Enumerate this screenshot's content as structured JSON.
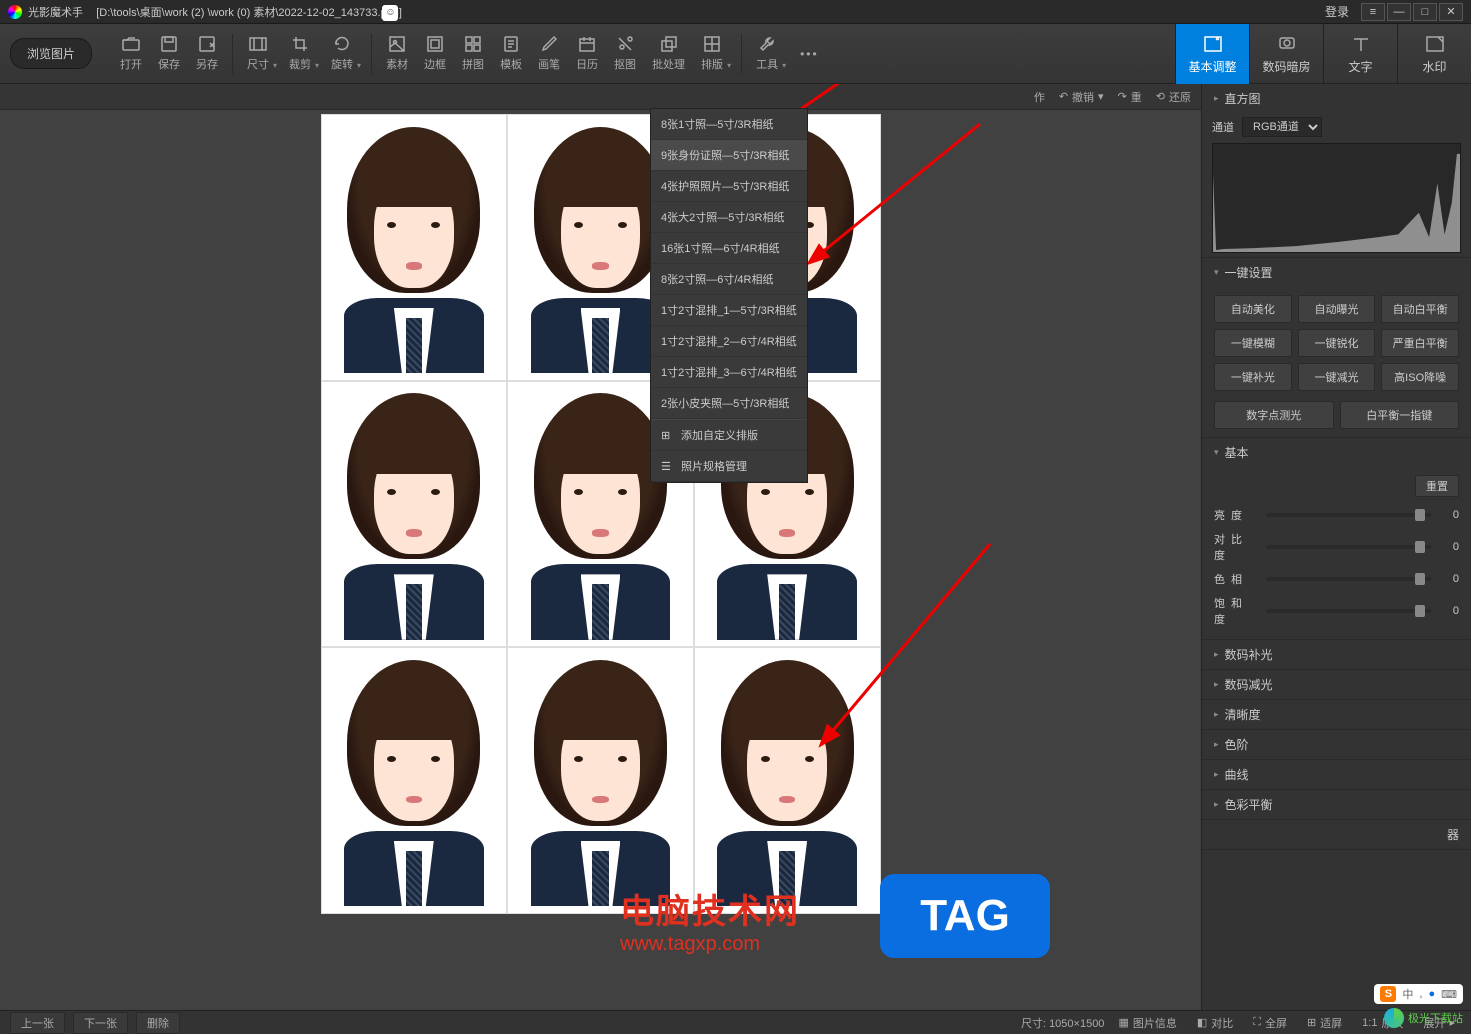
{
  "titlebar": {
    "app_name": "光影魔术手",
    "file_path": "[D:\\tools\\桌面\\work (2) \\work (0) 素材\\2022-12-02_143733.png]",
    "login": "登录"
  },
  "toolbar": {
    "browse": "浏览图片",
    "items": [
      {
        "id": "open",
        "label": "打开"
      },
      {
        "id": "save",
        "label": "保存"
      },
      {
        "id": "saveas",
        "label": "另存"
      },
      {
        "id": "size",
        "label": "尺寸"
      },
      {
        "id": "crop",
        "label": "裁剪"
      },
      {
        "id": "rotate",
        "label": "旋转"
      },
      {
        "id": "material",
        "label": "素材"
      },
      {
        "id": "border",
        "label": "边框"
      },
      {
        "id": "collage",
        "label": "拼图"
      },
      {
        "id": "template",
        "label": "模板"
      },
      {
        "id": "brush",
        "label": "画笔"
      },
      {
        "id": "calendar",
        "label": "日历"
      },
      {
        "id": "cutout",
        "label": "抠图"
      },
      {
        "id": "batch",
        "label": "批处理"
      },
      {
        "id": "layout",
        "label": "排版"
      },
      {
        "id": "tools",
        "label": "工具"
      }
    ],
    "right_tabs": [
      {
        "id": "basic",
        "label": "基本调整",
        "active": true
      },
      {
        "id": "darkroom",
        "label": "数码暗房"
      },
      {
        "id": "text",
        "label": "文字"
      },
      {
        "id": "watermark",
        "label": "水印"
      }
    ]
  },
  "sub_toolbar": {
    "op": "作",
    "undo": "撤销",
    "redo": "重",
    "restore": "还原"
  },
  "dropdown": {
    "items": [
      "8张1寸照—5寸/3R相纸",
      "9张身份证照—5寸/3R相纸",
      "4张护照照片—5寸/3R相纸",
      "4张大2寸照—5寸/3R相纸",
      "16张1寸照—6寸/4R相纸",
      "8张2寸照—6寸/4R相纸",
      "1寸2寸混排_1—5寸/3R相纸",
      "1寸2寸混排_2—6寸/4R相纸",
      "1寸2寸混排_3—6寸/4R相纸",
      "2张小皮夹照—5寸/3R相纸"
    ],
    "add_custom": "添加自定义排版",
    "manage": "照片规格管理",
    "hover_index": 1
  },
  "right_panel": {
    "histogram": {
      "title": "直方图",
      "channel_label": "通道",
      "channel_value": "RGB通道"
    },
    "oneclick": {
      "title": "一键设置",
      "buttons": [
        "自动美化",
        "自动曝光",
        "自动白平衡",
        "一键模糊",
        "一键锐化",
        "严重白平衡",
        "一键补光",
        "一键减光",
        "高ISO降噪"
      ],
      "buttons2": [
        "数字点测光",
        "白平衡一指键"
      ]
    },
    "basic": {
      "title": "基本",
      "reset": "重置",
      "sliders": [
        {
          "label": "亮度",
          "value": 0
        },
        {
          "label": "对比度",
          "value": 0
        },
        {
          "label": "色相",
          "value": 0
        },
        {
          "label": "饱和度",
          "value": 0
        }
      ]
    },
    "collapsed": [
      "数码补光",
      "数码减光",
      "清晰度",
      "色阶",
      "曲线",
      "色彩平衡"
    ],
    "more": "器"
  },
  "statusbar": {
    "prev": "上一张",
    "next": "下一张",
    "delete": "删除",
    "size_label": "尺寸:",
    "size_value": "1050×1500",
    "info": "图片信息",
    "compare": "对比",
    "fullscreen": "全屏",
    "fit": "适屏",
    "original": "原大",
    "expand": "展开"
  },
  "watermarks": {
    "site1_name": "电脑技术网",
    "site1_url": "www.tagxp.com",
    "tag": "TAG",
    "sogou": "中",
    "jiguang": "极光下载站"
  }
}
